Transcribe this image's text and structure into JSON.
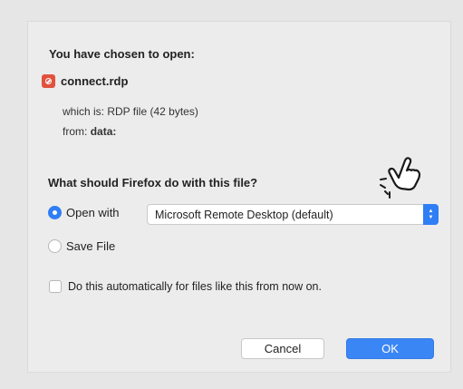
{
  "dialog": {
    "header": "You have chosen to open:",
    "file": {
      "icon": "rdp-file-icon",
      "name": "connect.rdp",
      "which_is": "which is:  RDP file (42 bytes)",
      "from_label": "from:",
      "from_value": "data:"
    },
    "question": "What should Firefox do with this file?",
    "options": {
      "open_with_label": "Open with",
      "open_with_app": "Microsoft Remote Desktop (default)",
      "save_file_label": "Save File",
      "selected": "open_with"
    },
    "auto_checkbox": {
      "label": "Do this automatically for files like this from now on.",
      "checked": false
    },
    "buttons": {
      "cancel": "Cancel",
      "ok": "OK"
    }
  },
  "colors": {
    "accent": "#2f7ef5",
    "file_icon": "#e2523f",
    "dialog_bg": "#ececec"
  },
  "cursor_icon": "hand-pointer-icon"
}
